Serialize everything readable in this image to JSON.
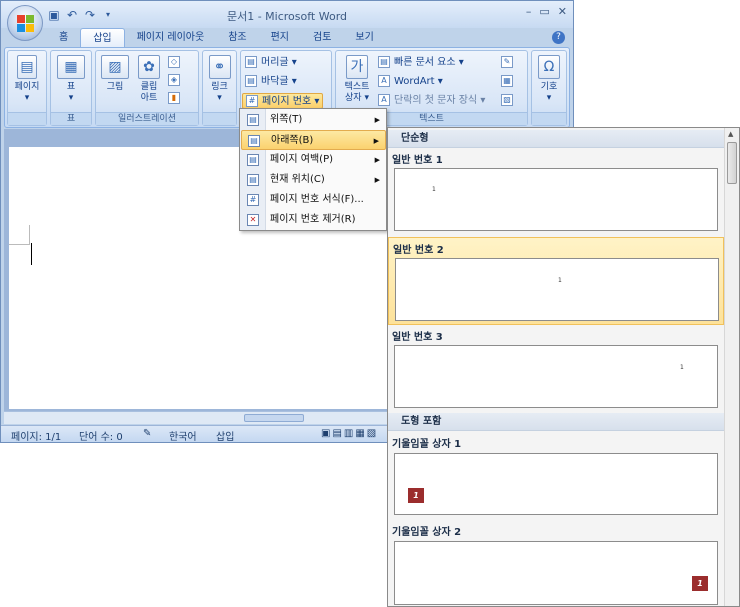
{
  "window": {
    "title": "문서1 - Microsoft Word",
    "min": "–",
    "max": "▭",
    "close": "✕"
  },
  "qat": {
    "save_icon": "save-icon",
    "undo_icon": "undo-icon",
    "redo_icon": "redo-icon"
  },
  "tabs": [
    "홈",
    "삽입",
    "페이지 레이아웃",
    "참조",
    "편지",
    "검토",
    "보기"
  ],
  "ribbon": {
    "groups": {
      "pages": {
        "label": "",
        "page_btn": "페이지"
      },
      "table": {
        "label": "표",
        "table_btn": "표"
      },
      "illustrations": {
        "label": "일러스트레이션",
        "picture_btn": "그림",
        "clipart_btn_1": "클립",
        "clipart_btn_2": "아트"
      },
      "links": {
        "label": "",
        "link_btn": "링크"
      },
      "header_footer": {
        "label": "",
        "header_btn": "머리글",
        "footer_btn": "바닥글",
        "page_number_btn": "페이지 번호"
      },
      "text": {
        "label": "텍스트",
        "textbox_btn_1": "텍스트",
        "textbox_btn_2": "상자",
        "quickparts_btn": "빠른 문서 요소",
        "wordart_btn": "WordArt",
        "dropcap_btn": "단락의 첫 문자 장식"
      },
      "symbols": {
        "label": "",
        "symbol_btn": "기호"
      }
    }
  },
  "menu": {
    "items": [
      {
        "label": "위쪽(T)",
        "submenu": true
      },
      {
        "label": "아래쪽(B)",
        "submenu": true,
        "active": true
      },
      {
        "label": "페이지 여백(P)",
        "submenu": true
      },
      {
        "label": "현재 위치(C)",
        "submenu": true
      },
      {
        "label": "페이지 번호 서식(F)...",
        "submenu": false
      },
      {
        "label": "페이지 번호 제거(R)",
        "submenu": false
      }
    ]
  },
  "gallery": {
    "categories": [
      "단순형",
      "도형 포함"
    ],
    "items": [
      {
        "title": "일반 번호 1",
        "num": "1"
      },
      {
        "title": "일반 번호 2",
        "num": "1"
      },
      {
        "title": "일반 번호 3",
        "num": "1"
      },
      {
        "title": "기울임꼴 상자 1",
        "num": "1"
      },
      {
        "title": "기울임꼴 상자 2",
        "num": "1"
      }
    ]
  },
  "status": {
    "page": "페이지: 1/1",
    "words": "단어 수: 0",
    "language": "한국어",
    "mode": "삽입"
  }
}
